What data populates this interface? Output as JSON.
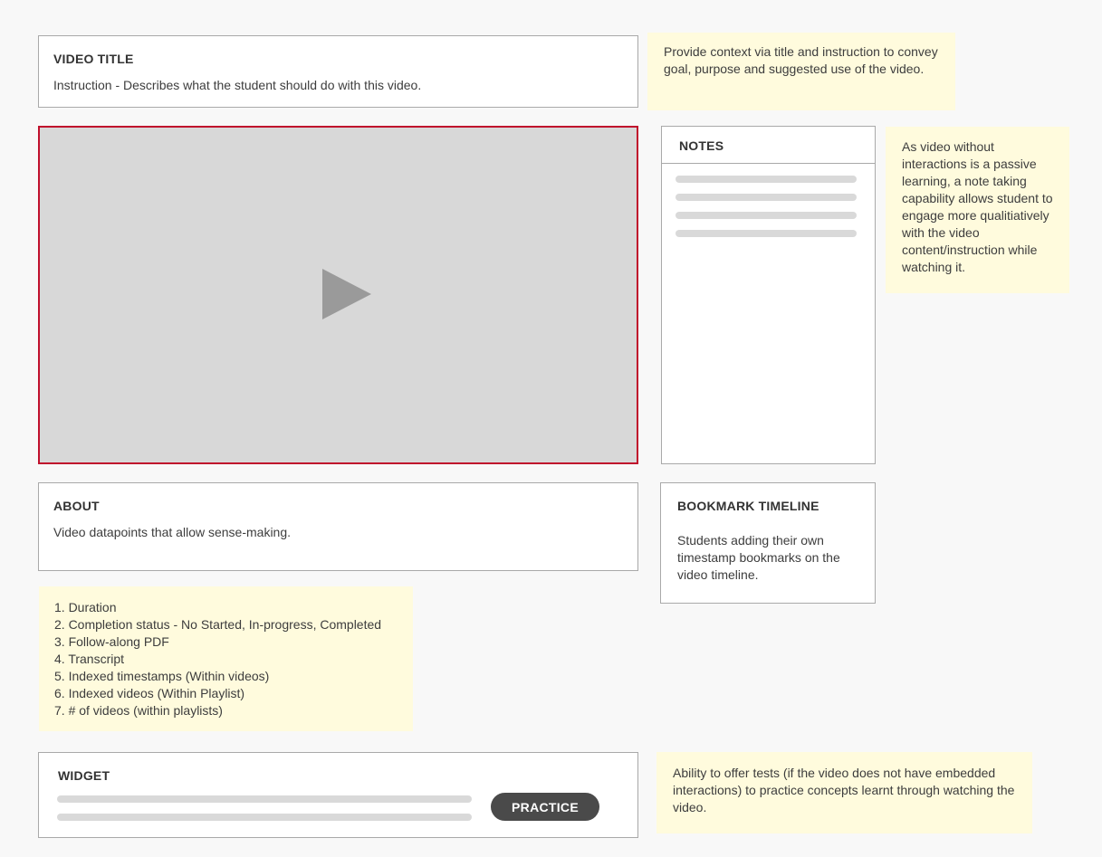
{
  "video_title": {
    "heading": "VIDEO TITLE",
    "instruction": "Instruction - Describes what the student should do with this video."
  },
  "notes_panel": {
    "heading": "NOTES"
  },
  "about": {
    "heading": "ABOUT",
    "text": "Video datapoints that allow sense-making."
  },
  "bookmark": {
    "heading": "BOOKMARK TIMELINE",
    "text": "Students adding their own timestamp bookmarks on the video timeline."
  },
  "widget": {
    "heading": "WIDGET",
    "button_label": "PRACTICE"
  },
  "annotations": {
    "title_note": "Provide context via title and instruction to convey goal, purpose and suggested use of the video.",
    "notes_note": "As video without interactions is a passive learning, a note taking capability allows student to engage more qualitiatively with the video content/instruction while watching it.",
    "about_list": [
      "1. Duration",
      "2. Completion status - No Started, In-progress, Completed",
      "3. Follow-along PDF",
      "4. Transcript",
      "5. Indexed timestamps (Within videos)",
      "6. Indexed videos (Within Playlist)",
      "7. # of videos (within playlists)"
    ],
    "widget_note": "Ability to offer tests (if the video does not have embedded interactions) to practice concepts learnt through watching the video."
  },
  "colors": {
    "player_border": "#c0102c",
    "player_bg": "#d8d8d8",
    "play_icon": "#9a9a9a",
    "note_bg": "#fffbdd",
    "button_bg": "#4a4a4a"
  },
  "icons": {
    "play": "play-icon"
  }
}
